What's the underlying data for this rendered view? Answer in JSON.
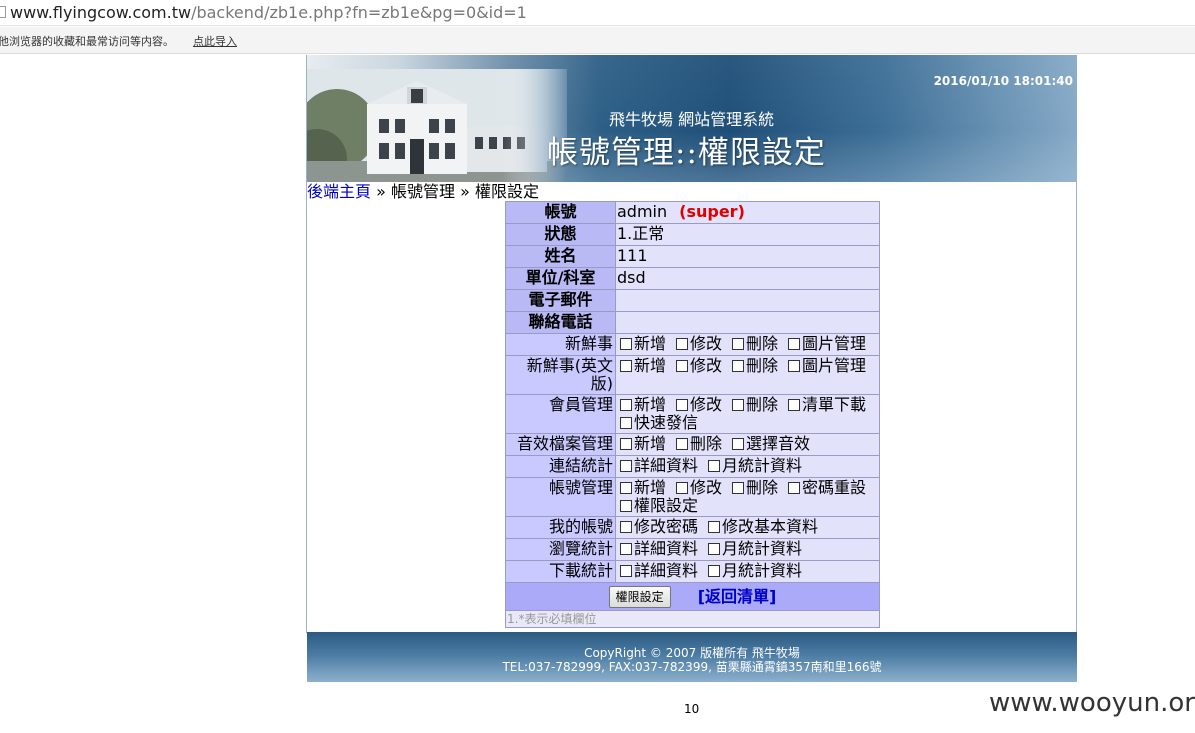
{
  "browser": {
    "url_host": "www.flyingcow.com.tw",
    "url_path": "/backend/zb1e.php?fn=zb1e&pg=0&id=1",
    "bookmark_message": "他浏览器的收藏和最常访问等内容。",
    "bookmark_import": "点此导入"
  },
  "banner": {
    "datetime": "2016/01/10 18:01:40",
    "subtitle": "飛牛牧場 網站管理系統",
    "title": "帳號管理::權限設定"
  },
  "breadcrumb": {
    "home": "後端主頁",
    "sep1": " » ",
    "section": "帳號管理",
    "sep2": " » ",
    "current": "權限設定"
  },
  "form": {
    "account_label": "帳號",
    "account_value": "admin",
    "account_badge": "(super)",
    "status_label": "狀態",
    "status_value": "1.正常",
    "name_label": "姓名",
    "name_value": "111",
    "unit_label": "單位/科室",
    "unit_value": "dsd",
    "email_label": "電子郵件",
    "email_value": "",
    "phone_label": "聯絡電話",
    "phone_value": "",
    "permissions": [
      {
        "label": "新鮮事",
        "options": [
          "新增",
          "修改",
          "刪除",
          "圖片管理"
        ]
      },
      {
        "label": "新鮮事(英文版)",
        "options": [
          "新增",
          "修改",
          "刪除",
          "圖片管理"
        ]
      },
      {
        "label": "會員管理",
        "options": [
          "新增",
          "修改",
          "刪除",
          "清單下載",
          "快速發信"
        ]
      },
      {
        "label": "音效檔案管理",
        "options": [
          "新增",
          "刪除",
          "選擇音效"
        ]
      },
      {
        "label": "連結統計",
        "options": [
          "詳細資料",
          "月統計資料"
        ]
      },
      {
        "label": "帳號管理",
        "options": [
          "新增",
          "修改",
          "刪除",
          "密碼重設",
          "權限設定"
        ]
      },
      {
        "label": "我的帳號",
        "options": [
          "修改密碼",
          "修改基本資料"
        ]
      },
      {
        "label": "瀏覽統計",
        "options": [
          "詳細資料",
          "月統計資料"
        ]
      },
      {
        "label": "下載統計",
        "options": [
          "詳細資料",
          "月統計資料"
        ]
      }
    ],
    "submit_label": "權限設定",
    "back_label": "[返回清單]",
    "note": "1.*表示必填欄位"
  },
  "footer": {
    "copyright": "CopyRight © 2007 版權所有 飛牛牧場",
    "contact": "TEL:037-782999, FAX:037-782399, 苗栗縣通霄鎮357南和里166號"
  },
  "page_number": "10",
  "watermark": "www.wooyun.org"
}
